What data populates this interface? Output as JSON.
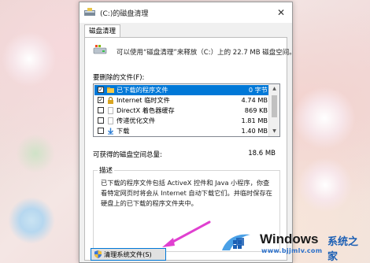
{
  "window": {
    "title": "(C:)的磁盘清理",
    "close_glyph": "✕"
  },
  "tab": {
    "label": "磁盘清理"
  },
  "summary": "可以使用“磁盘清理”来释放（C:）上的 22.7 MB 磁盘空间。",
  "files_to_delete_label": "要删除的文件(F):",
  "files": [
    {
      "name": "已下载的程序文件",
      "size": "0 字节",
      "checked": true,
      "selected": true,
      "icon": "folder-icon"
    },
    {
      "name": "Internet 临时文件",
      "size": "4.74 MB",
      "checked": true,
      "selected": false,
      "icon": "lock-icon"
    },
    {
      "name": "DirectX 着色器缓存",
      "size": "869 KB",
      "checked": false,
      "selected": false,
      "icon": "file-icon"
    },
    {
      "name": "传递优化文件",
      "size": "1.81 MB",
      "checked": false,
      "selected": false,
      "icon": "file-icon"
    },
    {
      "name": "下载",
      "size": "1.40 MB",
      "checked": false,
      "selected": false,
      "icon": "download-icon"
    }
  ],
  "checkmark_glyph": "✓",
  "scroll": {
    "up_glyph": "▲",
    "down_glyph": "▼"
  },
  "total": {
    "label": "可获得的磁盘空间总量:",
    "value": "18.6 MB"
  },
  "description": {
    "title": "描述",
    "text": "已下载的程序文件包括 ActiveX 控件和 Java 小程序，你查看特定网页时将会从 Internet 自动下载它们。并临时保存在硬盘上的已下载的程序文件夹中。"
  },
  "cleanup_button": "清理系统文件(S)",
  "watermark": {
    "brand": "Windows",
    "cn": "系统之家",
    "url": "www.bjjmlv.com"
  },
  "colors": {
    "selection": "#0078d7",
    "watermark_blue": "#1b5fb4",
    "arrow": "#e040d0"
  }
}
